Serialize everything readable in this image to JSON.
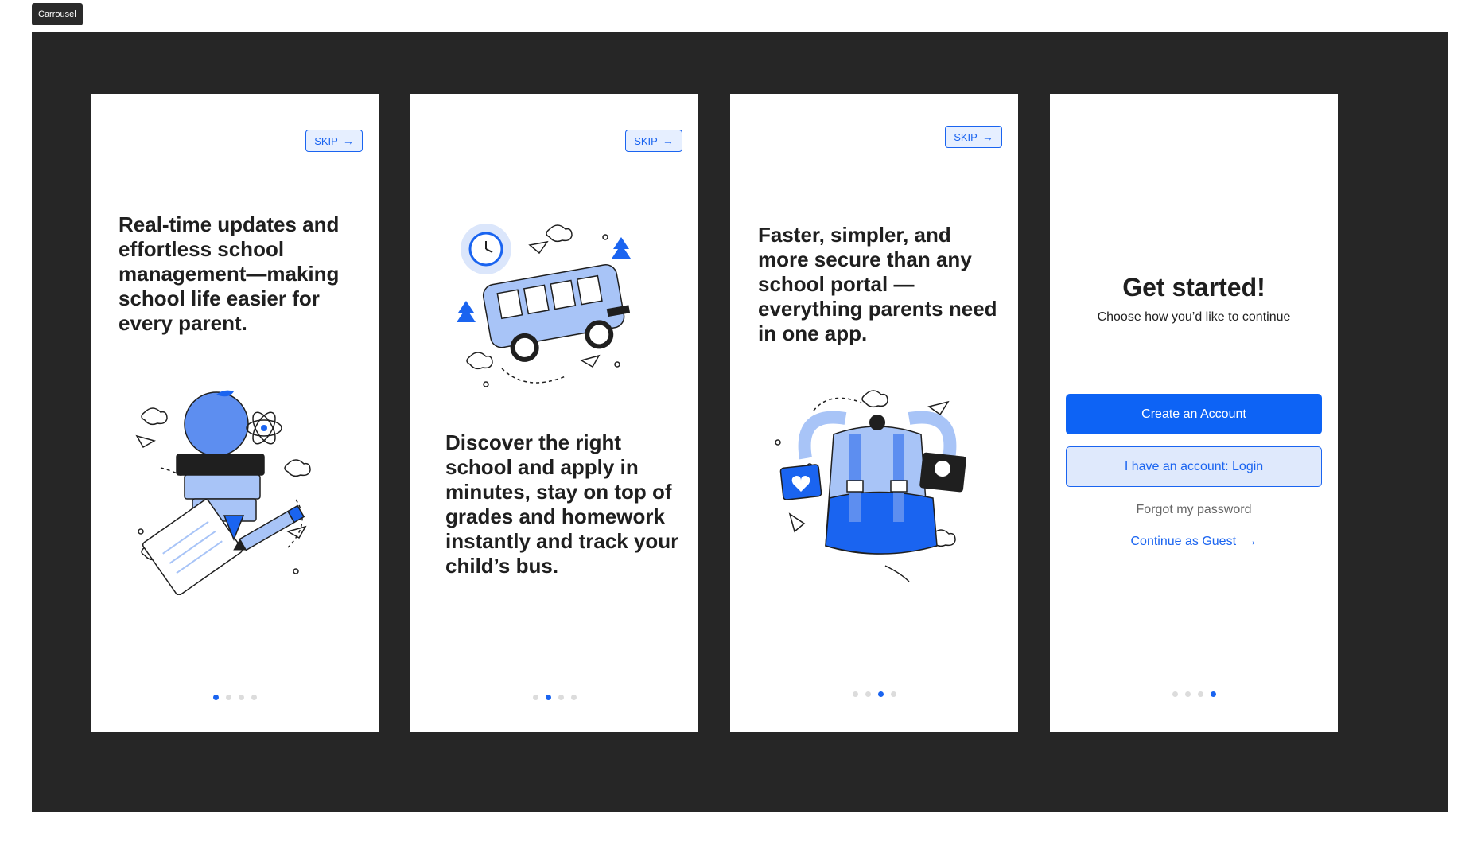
{
  "frame": {
    "label": "Carrousel"
  },
  "colors": {
    "accent": "#1a64f0",
    "canvas": "#262626",
    "light_blue": "#a8c4f7"
  },
  "screens": [
    {
      "skip_label": "SKIP",
      "headline": "Real-time updates and effortless school management—making school life easier for every parent.",
      "illustration": "apple-books-school-illustration",
      "active_dot": 1
    },
    {
      "skip_label": "SKIP",
      "headline": "Discover the right school and apply in minutes, stay on top of grades and homework instantly and track your child’s bus.",
      "illustration": "school-bus-illustration",
      "active_dot": 2
    },
    {
      "skip_label": "SKIP",
      "headline": "Faster, simpler, and more secure than any school portal — everything parents need in one app.",
      "illustration": "backpack-illustration",
      "active_dot": 3
    }
  ],
  "get_started": {
    "title": "Get started!",
    "subtitle": "Choose how you’d like to continue",
    "create_account": "Create an Account",
    "login": "I have an account: Login",
    "forgot": "Forgot my password",
    "guest": "Continue as Guest",
    "active_dot": 4
  },
  "icons": {
    "skip_arrow": "→",
    "guest_arrow": "→"
  }
}
